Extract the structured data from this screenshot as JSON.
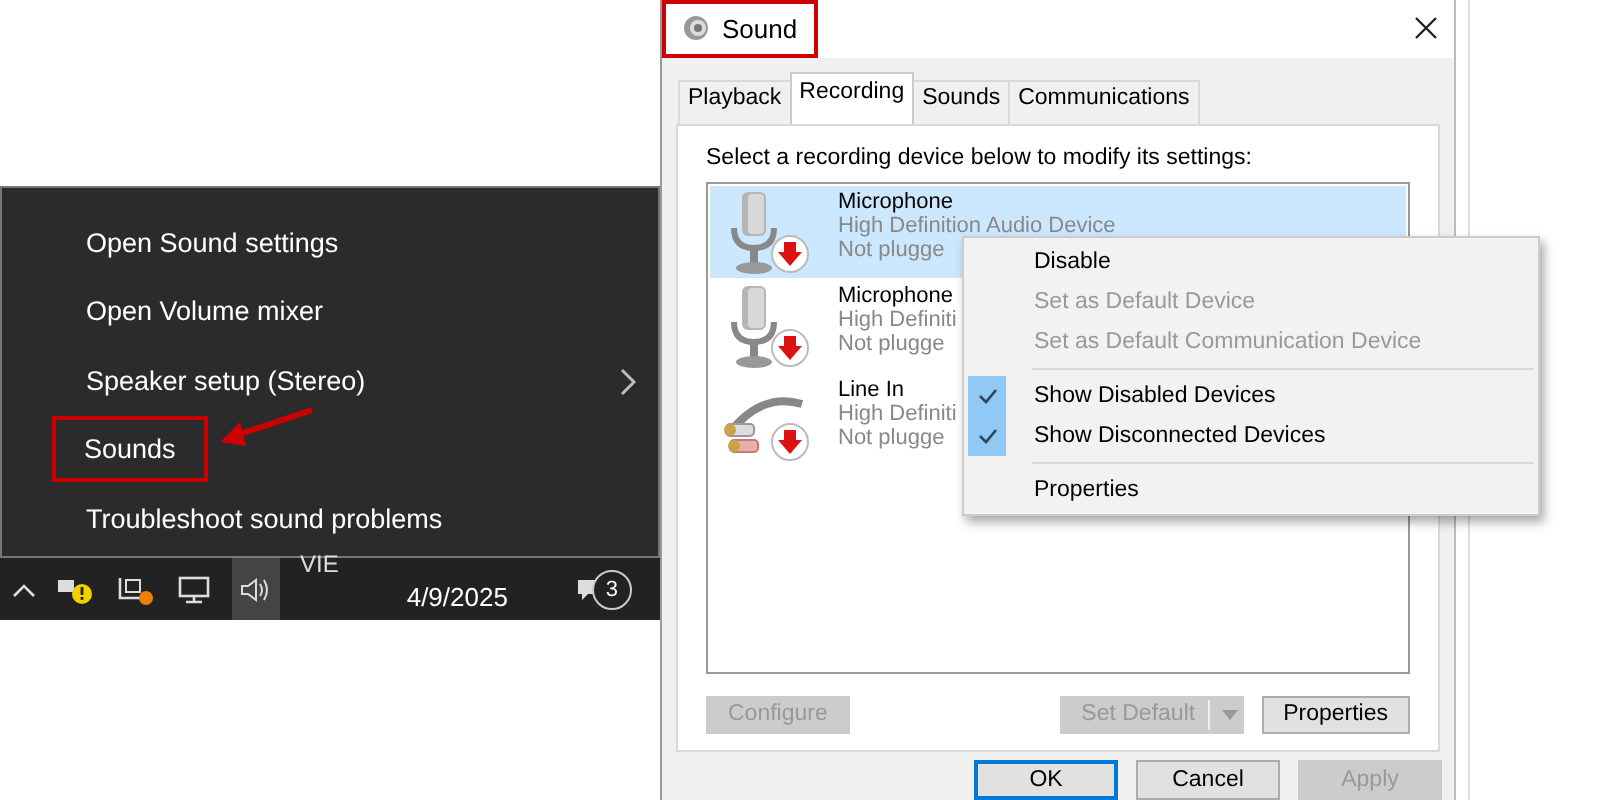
{
  "tray_menu": {
    "items": [
      {
        "label": "Open Sound settings",
        "submenu": false,
        "annotated": false
      },
      {
        "label": "Open Volume mixer",
        "submenu": false,
        "annotated": false
      },
      {
        "label": "Speaker setup (Stereo)",
        "submenu": true,
        "annotated": false
      },
      {
        "label": "Sounds",
        "submenu": false,
        "annotated": true
      },
      {
        "label": "Troubleshoot sound problems",
        "submenu": false,
        "annotated": false
      }
    ]
  },
  "taskbar": {
    "tray_text": "VIE",
    "date": "4/9/2025",
    "notification_count": "3"
  },
  "dialog": {
    "title": "Sound",
    "title_annotated": true,
    "tabs": [
      {
        "label": "Playback",
        "selected": false
      },
      {
        "label": "Recording",
        "selected": true
      },
      {
        "label": "Sounds",
        "selected": false
      },
      {
        "label": "Communications",
        "selected": false
      }
    ],
    "instruction": "Select a recording device below to modify its settings:",
    "devices": [
      {
        "kind": "microphone",
        "name": "Microphone",
        "description": "High Definition Audio Device",
        "status": "Not plugge",
        "selected": true
      },
      {
        "kind": "microphone",
        "name": "Microphone",
        "description": "High Definiti",
        "status": "Not plugge",
        "selected": false
      },
      {
        "kind": "line-in",
        "name": "Line In",
        "description": "High Definiti",
        "status": "Not plugge",
        "selected": false
      }
    ],
    "context_menu": [
      {
        "kind": "item",
        "label": "Disable",
        "disabled": false,
        "checked": false
      },
      {
        "kind": "item",
        "label": "Set as Default Device",
        "disabled": true,
        "checked": false
      },
      {
        "kind": "item",
        "label": "Set as Default Communication Device",
        "disabled": true,
        "checked": false
      },
      {
        "kind": "separator"
      },
      {
        "kind": "item",
        "label": "Show Disabled Devices",
        "disabled": false,
        "checked": true
      },
      {
        "kind": "item",
        "label": "Show Disconnected Devices",
        "disabled": false,
        "checked": true
      },
      {
        "kind": "separator"
      },
      {
        "kind": "item",
        "label": "Properties",
        "disabled": false,
        "checked": false
      }
    ],
    "device_buttons": [
      {
        "kind": "plain",
        "label": "Configure",
        "disabled": true
      },
      {
        "kind": "split",
        "label": "Set Default",
        "disabled": true
      },
      {
        "kind": "plain",
        "label": "Properties",
        "disabled": false
      }
    ],
    "footer_buttons": [
      {
        "label": "OK",
        "disabled": false,
        "default": true
      },
      {
        "label": "Cancel",
        "disabled": false,
        "default": false
      },
      {
        "label": "Apply",
        "disabled": true,
        "default": false
      }
    ]
  }
}
